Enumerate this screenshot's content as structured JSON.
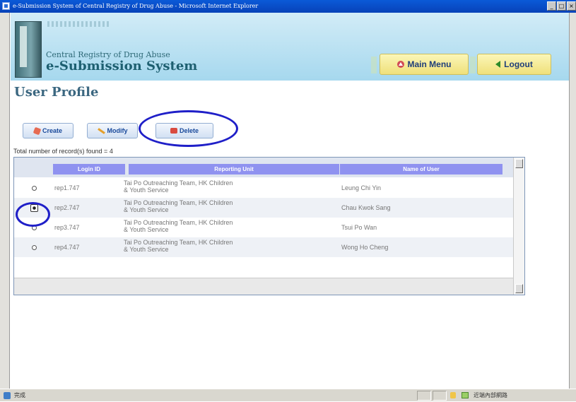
{
  "window": {
    "title": "e-Submission System of Central Registry of Drug Abuse - Microsoft Internet Explorer",
    "btn_min": "_",
    "btn_max": "□",
    "btn_close": "×"
  },
  "header": {
    "org_name": "Central Registry of Drug Abuse",
    "system_name": "e-Submission System",
    "main_menu_label": "Main Menu",
    "logout_label": "Logout"
  },
  "page": {
    "title": "User Profile"
  },
  "toolbar": {
    "create_label": "Create",
    "modify_label": "Modify",
    "delete_label": "Delete"
  },
  "records": {
    "summary": "Total number of record(s) found = 4"
  },
  "table": {
    "columns": [
      "Login ID",
      "Reporting Unit",
      "Name of User"
    ],
    "rows": [
      {
        "login_id": "rep1.747",
        "unit": "Tai Po Outreaching Team, HK Children & Youth Service",
        "name": "Leung Chi Yin",
        "selected": false
      },
      {
        "login_id": "rep2.747",
        "unit": "Tai Po Outreaching Team, HK Children & Youth Service",
        "name": "Chau Kwok Sang",
        "selected": true
      },
      {
        "login_id": "rep3.747",
        "unit": "Tai Po Outreaching Team, HK Children & Youth Service",
        "name": "Tsui Po Wan",
        "selected": false
      },
      {
        "login_id": "rep4.747",
        "unit": "Tai Po Outreaching Team, HK Children & Youth Service",
        "name": "Wong Ho Cheng",
        "selected": false
      }
    ]
  },
  "statusbar": {
    "status": "完成",
    "zone": "近端內部網路"
  },
  "colors": {
    "annotation_ring": "#1f1fc8",
    "header_cell": "#8f92f0",
    "title_bar": "#0842b8"
  }
}
